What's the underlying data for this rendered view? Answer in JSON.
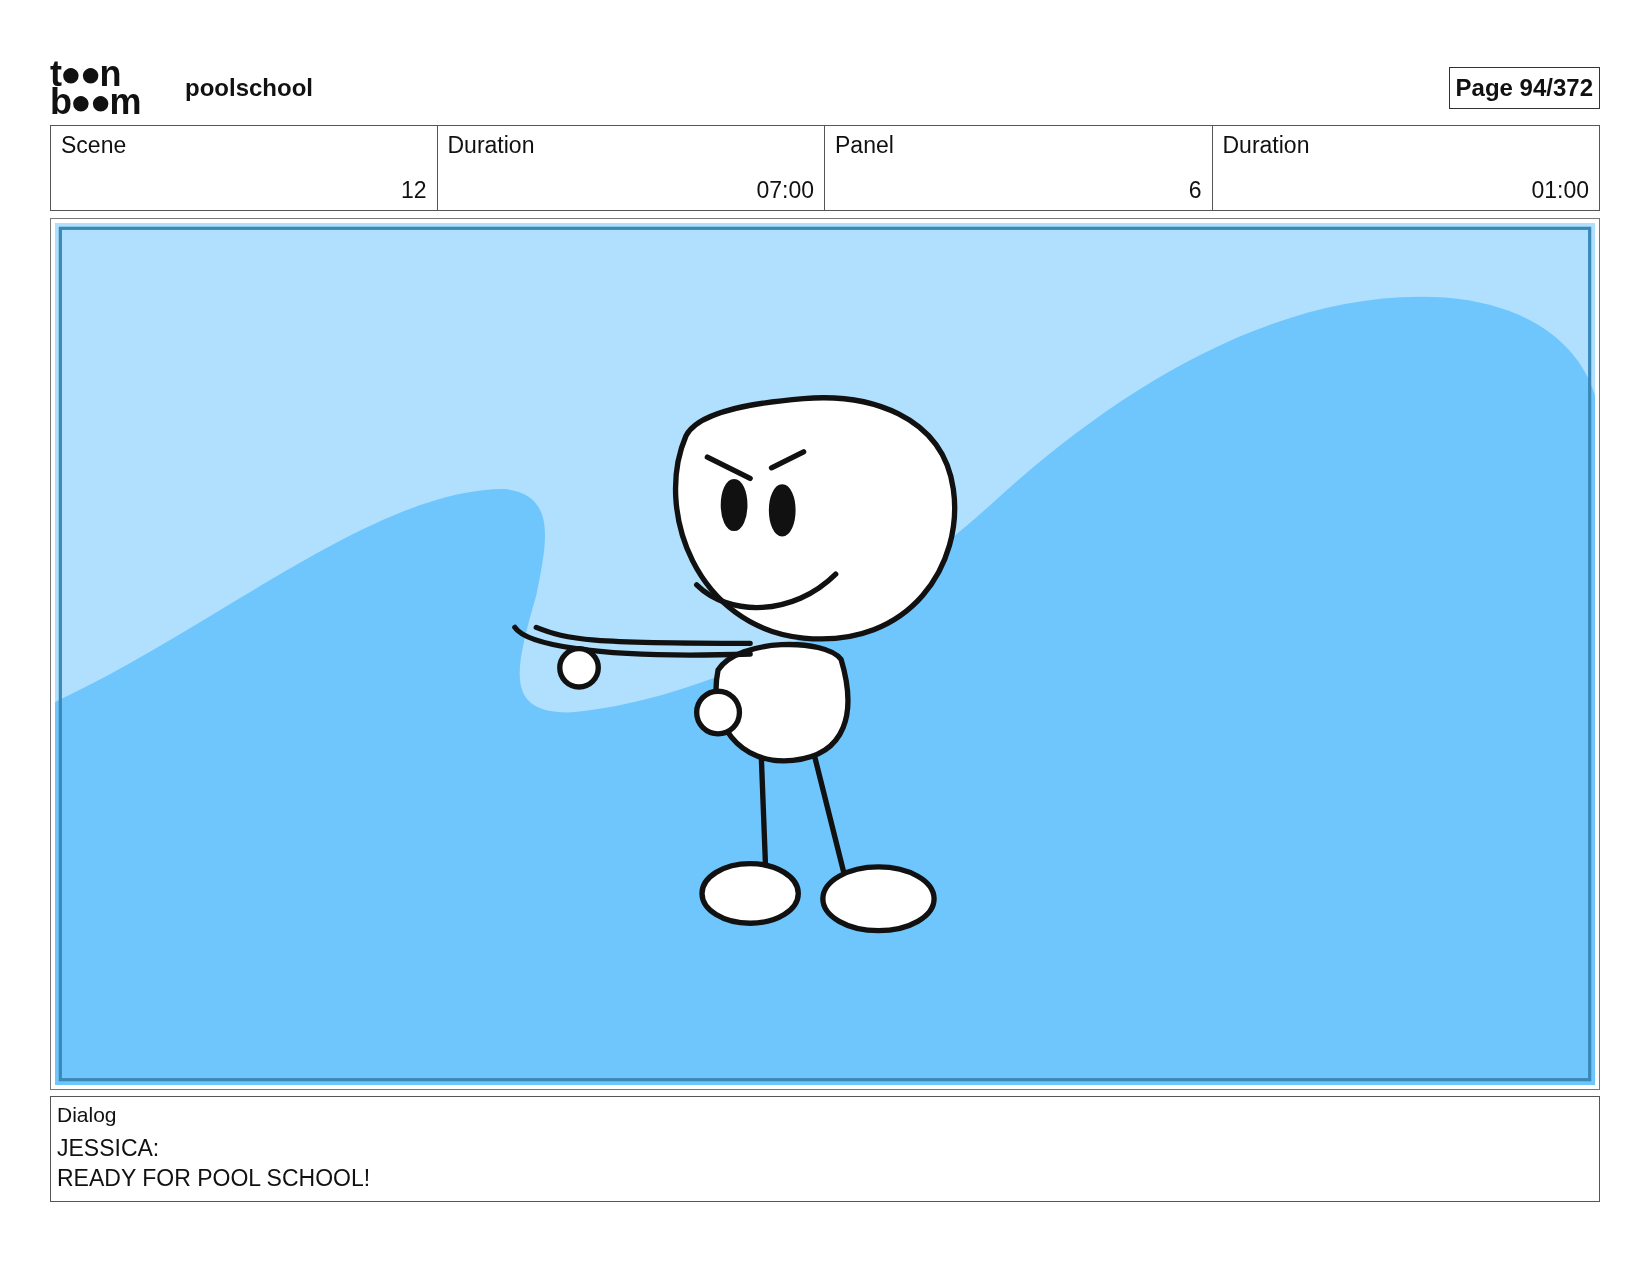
{
  "logo": [
    "t●●n",
    "b●●m"
  ],
  "project": "poolschool",
  "page": "Page  94/372",
  "fields": [
    {
      "label": "Scene",
      "value": "12"
    },
    {
      "label": "Duration",
      "value": "07:00"
    },
    {
      "label": "Panel",
      "value": "6"
    },
    {
      "label": "Duration",
      "value": "01:00"
    }
  ],
  "dialog": {
    "label": "Dialog",
    "lines": [
      "JESSICA:",
      "READY FOR POOL SCHOOL!"
    ]
  }
}
